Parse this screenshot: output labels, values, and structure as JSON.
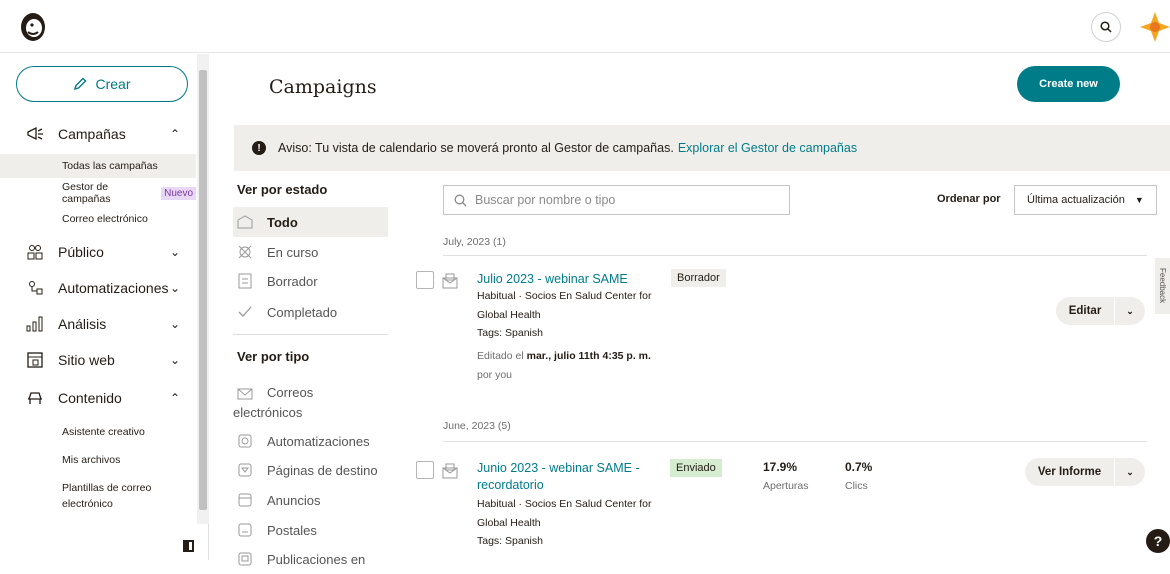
{
  "header": {
    "logo_icon": "mailchimp-freddie-icon",
    "search_icon": "search-icon"
  },
  "sidebar": {
    "create_label": "Crear",
    "nav": [
      {
        "label": "Campañas",
        "icon": "megaphone-icon",
        "expanded": true
      },
      {
        "label": "Público",
        "icon": "audience-icon",
        "expanded": false
      },
      {
        "label": "Automatizaciones",
        "icon": "automation-icon",
        "expanded": false
      },
      {
        "label": "Análisis",
        "icon": "analytics-icon",
        "expanded": false
      },
      {
        "label": "Sitio web",
        "icon": "website-icon",
        "expanded": false
      },
      {
        "label": "Contenido",
        "icon": "content-icon",
        "expanded": true
      }
    ],
    "campaign_sub": [
      "Todas las campañas",
      "Gestor de campañas",
      "Correo electrónico"
    ],
    "new_badge": "Nuevo",
    "content_sub": [
      "Asistente creativo",
      "Mis archivos",
      "Plantillas de correo electrónico"
    ]
  },
  "main": {
    "title": "Campaigns",
    "create_new": "Create new",
    "notice_text": "Aviso: Tu vista de calendario se moverá pronto al Gestor de campañas.",
    "notice_link": "Explorar el Gestor de campañas",
    "by_status_heading": "Ver por estado",
    "status_filters": [
      "Todo",
      "En curso",
      "Borrador",
      "Completado"
    ],
    "by_type_heading": "Ver por tipo",
    "type_filters": [
      "Correos electrónicos",
      "Automatizaciones",
      "Páginas de destino",
      "Anuncios",
      "Postales",
      "Publicaciones en"
    ],
    "search_placeholder": "Buscar por nombre o tipo",
    "sort_label": "Ordenar por",
    "sort_value": "Última actualización",
    "groups": [
      {
        "label": "July, 2023 (1)",
        "campaigns": [
          {
            "title": "Julio 2023 - webinar SAME",
            "audience": "Habitual · Socios En Salud Center for Global Health",
            "tags": "Tags: Spanish",
            "edited_prefix": "Editado el",
            "edited_date": "mar., julio 11th 4:35 p. m.",
            "edited_by": "por you",
            "status": "Borrador",
            "action": "Editar"
          }
        ]
      },
      {
        "label": "June, 2023 (5)",
        "campaigns": [
          {
            "title": "Junio 2023 - webinar SAME - recordatorio",
            "audience": "Habitual · Socios En Salud Center for Global Health",
            "tags": "Tags: Spanish",
            "status": "Enviado",
            "opens_value": "17.9%",
            "opens_label": "Aperturas",
            "clicks_value": "0.7%",
            "clicks_label": "Clics",
            "action": "Ver Informe"
          }
        ]
      }
    ],
    "feedback_label": "Feedback",
    "help_label": "?"
  },
  "colors": {
    "accent": "#007c89",
    "sidebar_active": "#efeeea",
    "sent_badge": "#d5ecd1"
  }
}
